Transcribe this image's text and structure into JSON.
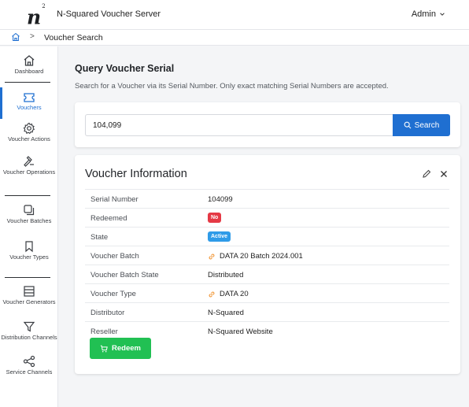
{
  "app": {
    "logo_text": "n",
    "logo_sup": "2",
    "title": "N-Squared Voucher Server",
    "user_menu": "Admin"
  },
  "breadcrumb": {
    "separator": ">",
    "current": "Voucher Search"
  },
  "sidebar": {
    "items": [
      {
        "label": "Dashboard",
        "icon": "home-icon"
      },
      {
        "label": "Vouchers",
        "icon": "ticket-icon",
        "active": true
      },
      {
        "label": "Voucher Actions",
        "icon": "gear-icon"
      },
      {
        "label": "Voucher Operations",
        "icon": "hammer-icon"
      },
      {
        "label": "Voucher Batches",
        "icon": "copy-icon"
      },
      {
        "label": "Voucher Types",
        "icon": "bookmark-icon"
      },
      {
        "label": "Voucher Generators",
        "icon": "server-icon"
      },
      {
        "label": "Distribution Channels",
        "icon": "filter-icon"
      },
      {
        "label": "Service Channels",
        "icon": "share-icon"
      }
    ]
  },
  "query": {
    "title": "Query Voucher Serial",
    "description": "Search for a Voucher via its Serial Number. Only exact matching Serial Numbers are accepted.",
    "input_value": "104,099",
    "search_label": "Search"
  },
  "info": {
    "title": "Voucher Information",
    "rows": [
      {
        "label": "Serial Number",
        "value": "104099"
      },
      {
        "label": "Redeemed",
        "badge": "No",
        "badge_color": "#e53945"
      },
      {
        "label": "State",
        "badge": "Active",
        "badge_color": "#2f9be8"
      },
      {
        "label": "Voucher Batch",
        "value": "DATA 20 Batch 2024.001",
        "link": true
      },
      {
        "label": "Voucher Batch State",
        "value": "Distributed"
      },
      {
        "label": "Voucher Type",
        "value": "DATA 20",
        "link": true
      },
      {
        "label": "Distributor",
        "value": "N-Squared"
      },
      {
        "label": "Reseller",
        "value": "N-Squared Website"
      }
    ],
    "redeem_label": "Redeem"
  },
  "colors": {
    "primary": "#1f6fd1",
    "success": "#21c053",
    "danger": "#e53945",
    "info": "#2f9be8",
    "link_icon": "#f0922e"
  }
}
